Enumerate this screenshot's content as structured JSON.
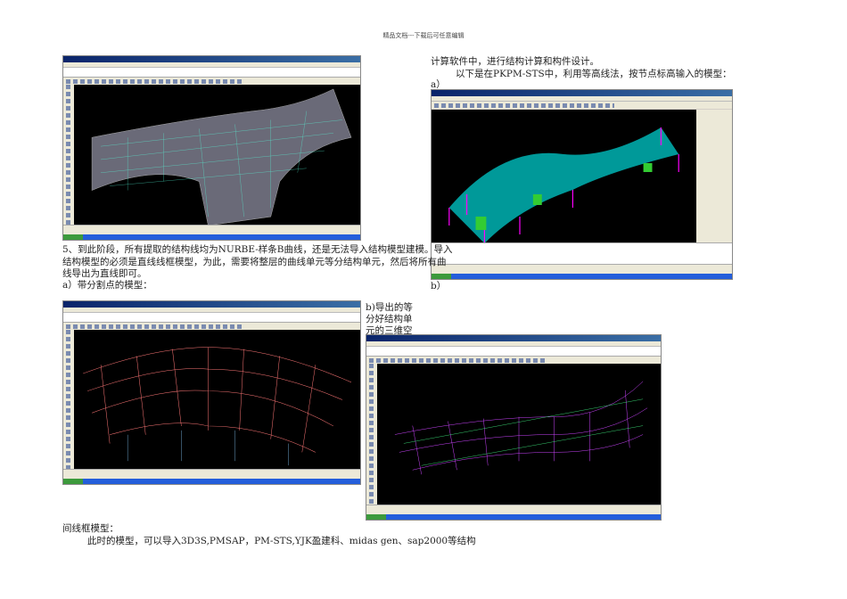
{
  "header": "精品文档---下载后可任意编辑",
  "right_col": {
    "line1": "计算软件中，进行结构计算和构件设计。",
    "line2": "以下是在PKPM-STS中，利用等高线法，按节点标高输入的模型：",
    "label_a": "a）",
    "label_b": "b）"
  },
  "para5": {
    "line1": "5、到此阶段，所有提取的结构线均为NURBE-样条B曲线，还是无法导入结构模型建模。导入",
    "line2": "结构模型的必须是直线线框模型，为此，需要将整层的曲线单元等分结构单元，然后将所有曲",
    "line3": "线导出为直线即可。",
    "label_a": "a）带分割点的模型："
  },
  "caption_b": {
    "line1": "b)导出的等",
    "line2": "分好结构单",
    "line3": "元的三维空"
  },
  "bottom": {
    "line1": "间线框模型：",
    "line2": "此时的模型，可以导入3D3S,PMSAP，PM-STS,YJK盈建科、midas gen、sap2000等结构"
  }
}
